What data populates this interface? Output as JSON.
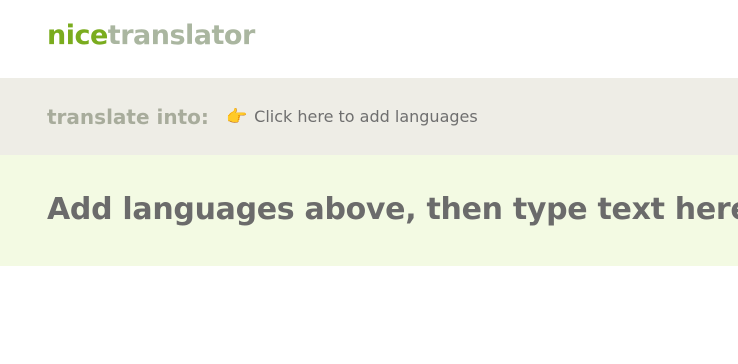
{
  "logo": {
    "part1": "nice",
    "part2": "translator",
    "color_part1": "#7aac1e",
    "color_part2": "#aab6a0"
  },
  "lang_bar": {
    "label": "translate into:",
    "add_icon": "pointing-hand-icon",
    "add_text": "Click here to add languages"
  },
  "input": {
    "placeholder": "Add languages above, then type text here"
  }
}
